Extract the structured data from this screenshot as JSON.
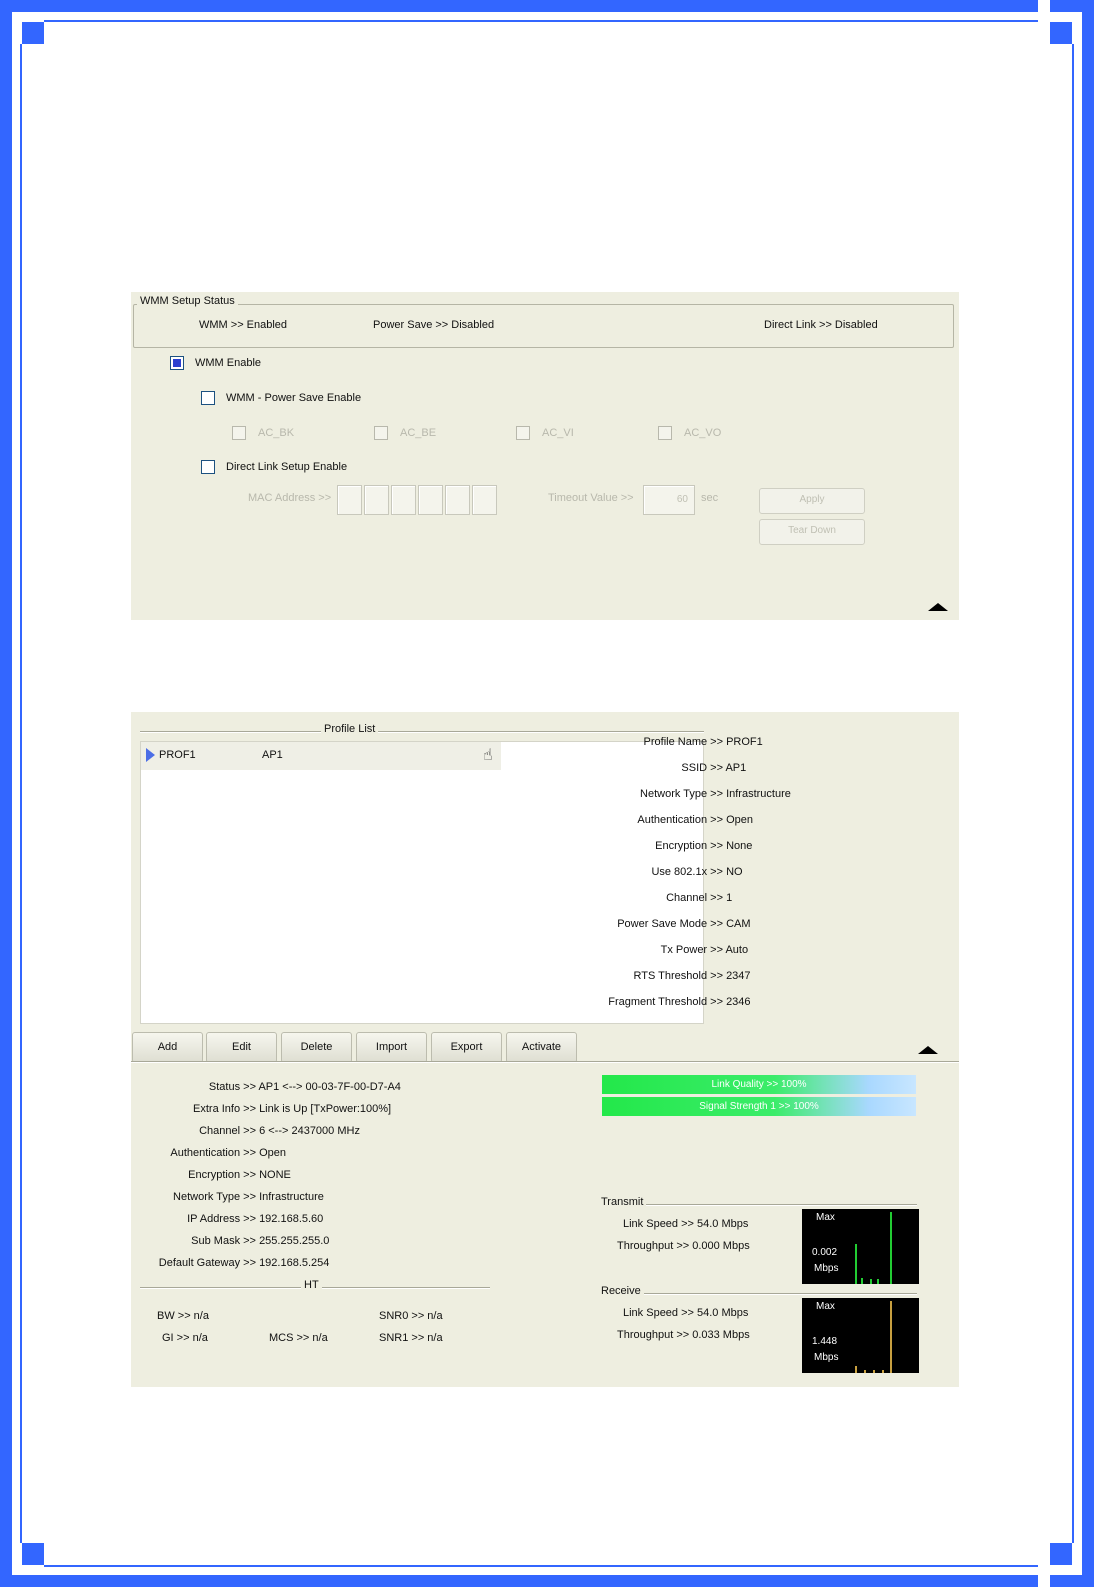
{
  "colors": {
    "frame": "#3366ff",
    "panel": "#eeeee0",
    "graph_bg": "#000000",
    "tx_line": "#22cc33",
    "rx_line": "#c8a040"
  },
  "wmm": {
    "group_title": "WMM Setup Status",
    "status": {
      "wmm": "WMM >> Enabled",
      "power_save": "Power Save >> Disabled",
      "direct_link": "Direct Link >> Disabled"
    },
    "wmm_enable": {
      "label": "WMM Enable",
      "checked": true
    },
    "power_save_enable": {
      "label": "WMM - Power Save Enable",
      "checked": false
    },
    "ac": [
      "AC_BK",
      "AC_BE",
      "AC_VI",
      "AC_VO"
    ],
    "direct_link_enable": {
      "label": "Direct Link Setup Enable",
      "checked": false
    },
    "mac_label": "MAC Address >>",
    "timeout_label": "Timeout Value >>",
    "timeout_value": "60",
    "timeout_unit": "sec",
    "apply": "Apply",
    "tear_down": "Tear Down"
  },
  "profile": {
    "group_title": "Profile List",
    "rows": [
      {
        "name": "PROF1",
        "ssid": "AP1"
      }
    ],
    "buttons": [
      "Add",
      "Edit",
      "Delete",
      "Import",
      "Export",
      "Activate"
    ],
    "details": [
      {
        "label": "Profile Name >>",
        "value": "PROF1"
      },
      {
        "label": "SSID >>",
        "value": "AP1"
      },
      {
        "label": "Network Type >>",
        "value": "Infrastructure"
      },
      {
        "label": "Authentication >>",
        "value": "Open"
      },
      {
        "label": "Encryption >>",
        "value": "None"
      },
      {
        "label": "Use 802.1x >>",
        "value": "NO"
      },
      {
        "label": "Channel >>",
        "value": "1"
      },
      {
        "label": "Power Save Mode >>",
        "value": "CAM"
      },
      {
        "label": "Tx Power >>",
        "value": "Auto"
      },
      {
        "label": "RTS Threshold >>",
        "value": "2347"
      },
      {
        "label": "Fragment Threshold >>",
        "value": "2346"
      }
    ]
  },
  "status": {
    "items": [
      {
        "label": "Status >>",
        "value": "AP1 <--> 00-03-7F-00-D7-A4"
      },
      {
        "label": "Extra Info >>",
        "value": "Link is Up [TxPower:100%]"
      },
      {
        "label": "Channel >>",
        "value": "6 <--> 2437000 MHz"
      },
      {
        "label": "Authentication >>",
        "value": "Open"
      },
      {
        "label": "Encryption >>",
        "value": "NONE"
      },
      {
        "label": "Network Type >>",
        "value": "Infrastructure"
      },
      {
        "label": "IP Address >>",
        "value": "192.168.5.60"
      },
      {
        "label": "Sub Mask >>",
        "value": "255.255.255.0"
      },
      {
        "label": "Default Gateway >>",
        "value": "192.168.5.254"
      }
    ],
    "ht_title": "HT",
    "bw": "BW >> n/a",
    "gi": "GI >> n/a",
    "mcs": "MCS >> n/a",
    "snr0": "SNR0 >> n/a",
    "snr1": "SNR1 >> n/a",
    "link_quality": {
      "label": "Link Quality >> 100%",
      "percent": 100
    },
    "signal_strength": {
      "label": "Signal Strength 1 >> 100%",
      "percent": 100
    },
    "transmit": {
      "title": "Transmit",
      "link_speed": "Link Speed >> 54.0 Mbps",
      "throughput": "Throughput >> 0.000 Mbps",
      "graph_max": "Max",
      "graph_value": "0.002",
      "graph_unit": "Mbps"
    },
    "receive": {
      "title": "Receive",
      "link_speed": "Link Speed >> 54.0 Mbps",
      "throughput": "Throughput >> 0.033 Mbps",
      "graph_max": "Max",
      "graph_value": "1.448",
      "graph_unit": "Mbps"
    }
  }
}
